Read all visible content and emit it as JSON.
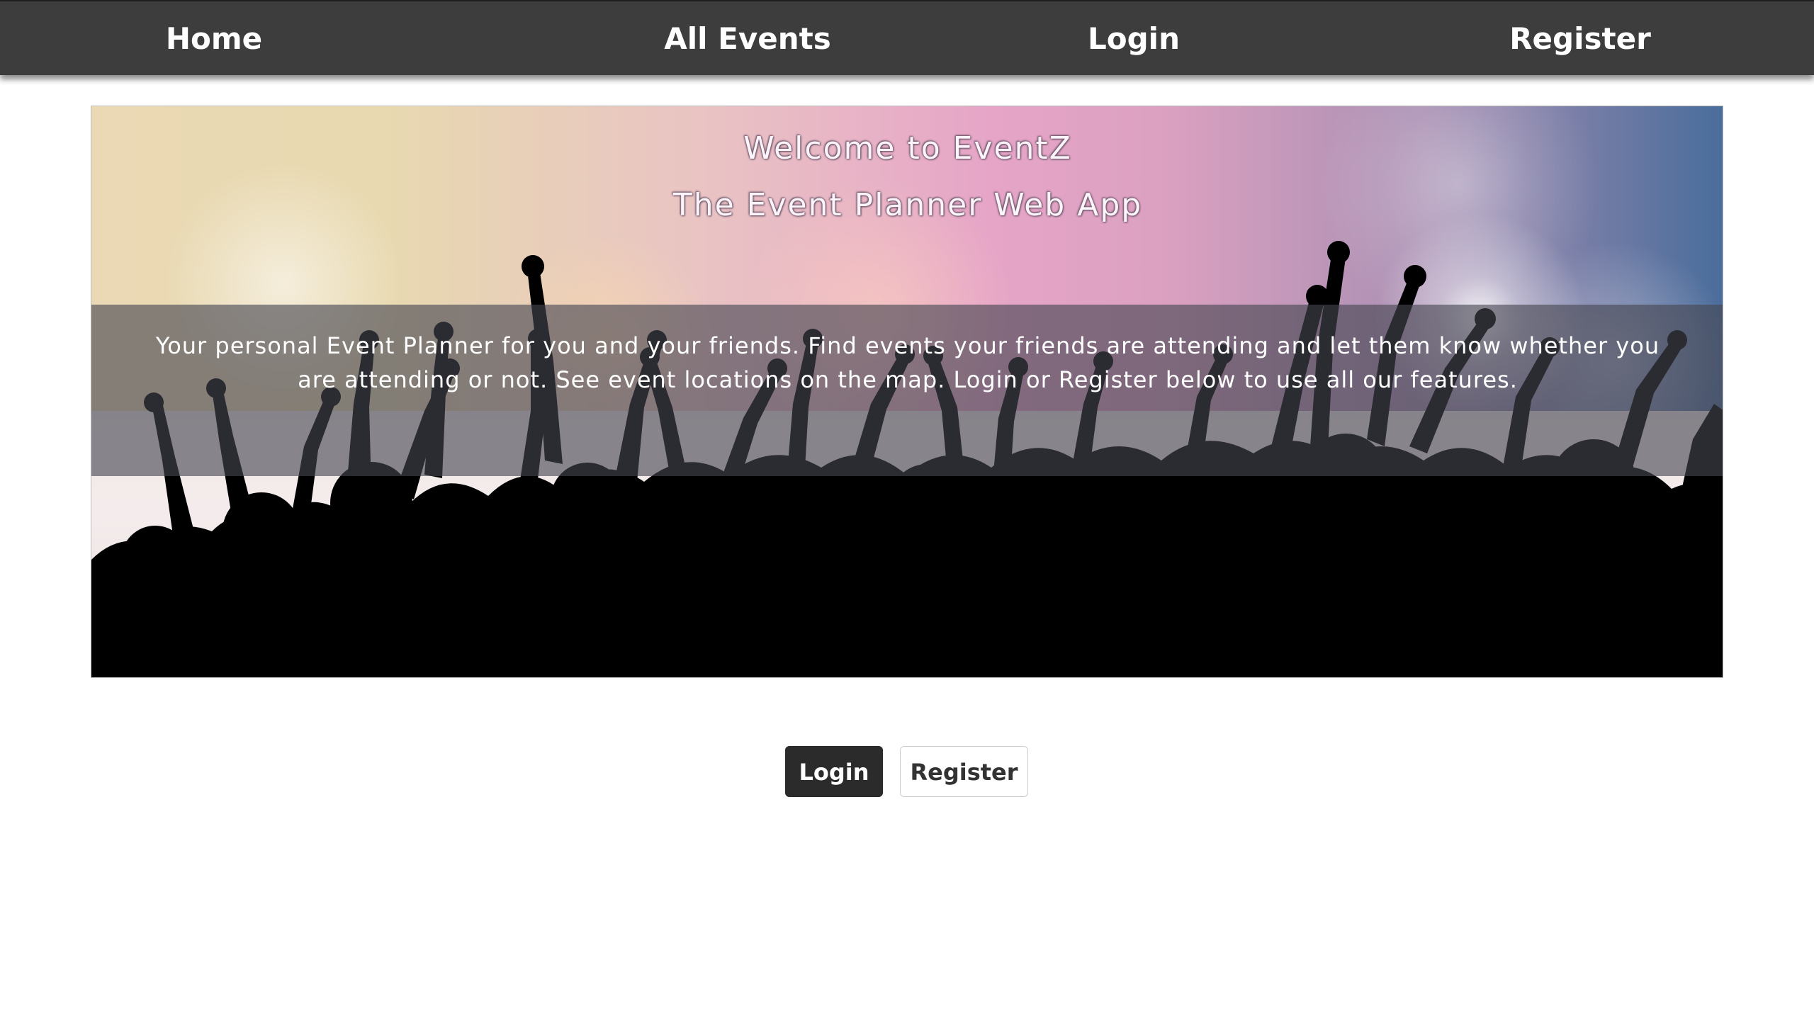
{
  "navbar": {
    "items": [
      {
        "label": "Home"
      },
      {
        "label": "All Events"
      },
      {
        "label": "Login"
      },
      {
        "label": "Register"
      }
    ]
  },
  "hero": {
    "title": "Welcome to EventZ",
    "subtitle": "The Event Planner Web App",
    "description": "Your personal Event Planner for you and your friends. Find events your friends are attending and let them know whether you are attending or not. See event locations on the map. Login or Register below to use all our features."
  },
  "actions": {
    "login_label": "Login",
    "register_label": "Register"
  },
  "colors": {
    "navbar_bg": "#3d3d3d",
    "primary_button": "#2b2b2b",
    "page_bg": "#ffffff"
  }
}
